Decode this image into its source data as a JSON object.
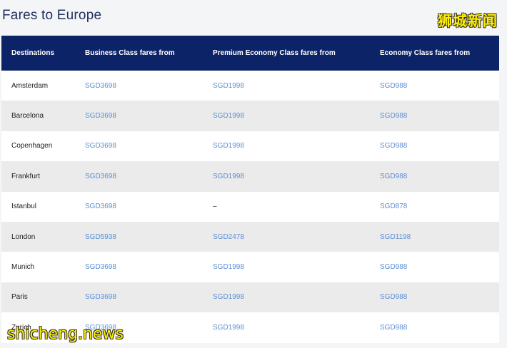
{
  "page": {
    "title": "Fares to Europe"
  },
  "table": {
    "headers": [
      "Destinations",
      "Business Class fares from",
      "Premium Economy Class fares from",
      "Economy Class fares from"
    ],
    "rows": [
      [
        "Amsterdam",
        "SGD3698",
        "SGD1998",
        "SGD988"
      ],
      [
        "Barcelona",
        "SGD3698",
        "SGD1998",
        "SGD988"
      ],
      [
        "Copenhagen",
        "SGD3698",
        "SGD1998",
        "SGD988"
      ],
      [
        "Frankfurt",
        "SGD3698",
        "SGD1998",
        "SGD988"
      ],
      [
        "Istanbul",
        "SGD3698",
        "–",
        "SGD878"
      ],
      [
        "London",
        "SGD5938",
        "SGD2478",
        "SGD1198"
      ],
      [
        "Munich",
        "SGD3698",
        "SGD1998",
        "SGD988"
      ],
      [
        "Paris",
        "SGD3698",
        "SGD1998",
        "SGD988"
      ],
      [
        "Zurich",
        "SGD3698",
        "SGD1998",
        "SGD988"
      ]
    ]
  },
  "watermarks": {
    "top_right": "狮城新闻",
    "bottom_left": "shicheng.news"
  },
  "colors": {
    "header_bg": "#0c2467",
    "fare_link": "#5b8fd6",
    "title": "#1f2f5e",
    "watermark": "#ffee00"
  }
}
